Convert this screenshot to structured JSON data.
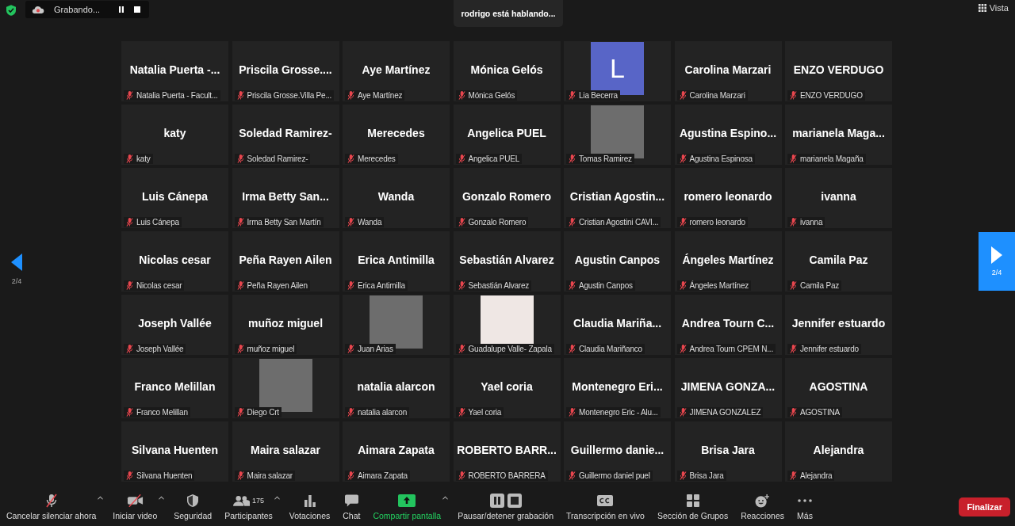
{
  "top_bar": {
    "recording": {
      "label": "Grabando...",
      "paused": false
    },
    "speaker": "rodrigo está hablando...",
    "view_button": "Vista"
  },
  "pager": {
    "left": "2/4",
    "right": "2/4"
  },
  "tiles": [
    {
      "kind": "name",
      "display": "Natalia Puerta -...",
      "label": "Natalia Puerta - Facult...",
      "muted": true
    },
    {
      "kind": "name",
      "display": "Priscila Grosse....",
      "label": "Priscila Grosse.Villa Pe...",
      "muted": true
    },
    {
      "kind": "name",
      "display": "Aye Martínez",
      "label": "Aye Martínez",
      "muted": true
    },
    {
      "kind": "name",
      "display": "Mónica Gelós",
      "label": "Mónica Gelós",
      "muted": true
    },
    {
      "kind": "avatar",
      "display": "L",
      "color": "#5865c7",
      "label": "Lia Becerra",
      "muted": true
    },
    {
      "kind": "name",
      "display": "Carolina Marzari",
      "label": "Carolina Marzari",
      "muted": true
    },
    {
      "kind": "name",
      "display": "ENZO VERDUGO",
      "label": "ENZO VERDUGO",
      "muted": true
    },
    {
      "kind": "name",
      "display": "katy",
      "label": "katy",
      "muted": true
    },
    {
      "kind": "name",
      "display": "Soledad Ramirez-",
      "label": "Soledad Ramirez-",
      "muted": true
    },
    {
      "kind": "name",
      "display": "Merecedes",
      "label": "Merecedes",
      "muted": true
    },
    {
      "kind": "name",
      "display": "Angelica PUEL",
      "label": "Angelica PUEL",
      "muted": true
    },
    {
      "kind": "photo",
      "label": "Tomas Ramirez",
      "muted": true
    },
    {
      "kind": "name",
      "display": "Agustina Espino...",
      "label": "Agustina Espinosa",
      "muted": true
    },
    {
      "kind": "name",
      "display": "marianela Maga...",
      "label": "marianela Magaña",
      "muted": true
    },
    {
      "kind": "name",
      "display": "Luis Cánepa",
      "label": "Luis Cánepa",
      "muted": true
    },
    {
      "kind": "name",
      "display": "Irma Betty San...",
      "label": "Irma Betty San Martín",
      "muted": true
    },
    {
      "kind": "name",
      "display": "Wanda",
      "label": "Wanda",
      "muted": true
    },
    {
      "kind": "name",
      "display": "Gonzalo Romero",
      "label": "Gonzalo Romero",
      "muted": true
    },
    {
      "kind": "name",
      "display": "Cristian Agostin...",
      "label": "Cristian Agostini CAVI...",
      "muted": true
    },
    {
      "kind": "name",
      "display": "romero leonardo",
      "label": "romero leonardo",
      "muted": true
    },
    {
      "kind": "name",
      "display": "ivanna",
      "label": "ivanna",
      "muted": true
    },
    {
      "kind": "name",
      "display": "Nicolas cesar",
      "label": "Nicolas cesar",
      "muted": true
    },
    {
      "kind": "name",
      "display": "Peña Rayen Ailen",
      "label": "Peña Rayen Ailen",
      "muted": true
    },
    {
      "kind": "name",
      "display": "Erica Antimilla",
      "label": "Erica Antimilla",
      "muted": true
    },
    {
      "kind": "name",
      "display": "Sebastián Alvarez",
      "label": "Sebastián Alvarez",
      "muted": true
    },
    {
      "kind": "name",
      "display": "Agustin Canpos",
      "label": "Agustin Canpos",
      "muted": true
    },
    {
      "kind": "name",
      "display": "Ángeles Martínez",
      "label": "Ángeles Martínez",
      "muted": true
    },
    {
      "kind": "name",
      "display": "Camila Paz",
      "label": "Camila Paz",
      "muted": true
    },
    {
      "kind": "name",
      "display": "Joseph Vallée",
      "label": "Joseph Vallée",
      "muted": true
    },
    {
      "kind": "name",
      "display": "muñoz miguel",
      "label": "muñoz miguel",
      "muted": true
    },
    {
      "kind": "photo",
      "label": "Juan Arias",
      "muted": true
    },
    {
      "kind": "logo",
      "label": "Guadalupe Valle- Zapala",
      "muted": true
    },
    {
      "kind": "name",
      "display": "Claudia Mariña...",
      "label": "Claudia Mariñanco",
      "muted": true
    },
    {
      "kind": "name",
      "display": "Andrea Tourn C...",
      "label": "Andrea Tourn CPEM N...",
      "muted": true
    },
    {
      "kind": "name",
      "display": "Jennifer estuardo",
      "label": "Jennifer estuardo",
      "muted": true
    },
    {
      "kind": "name",
      "display": "Franco Melillan",
      "label": "Franco Melillan",
      "muted": true
    },
    {
      "kind": "photo",
      "label": "Diego Crt",
      "muted": true
    },
    {
      "kind": "name",
      "display": "natalia alarcon",
      "label": "natalia alarcon",
      "muted": true
    },
    {
      "kind": "name",
      "display": "Yael coria",
      "label": "Yael coria",
      "muted": true
    },
    {
      "kind": "name",
      "display": "Montenegro Eri...",
      "label": "Montenegro Eric - Alu...",
      "muted": true
    },
    {
      "kind": "name",
      "display": "JIMENA GONZA...",
      "label": "JIMENA GONZALEZ",
      "muted": true
    },
    {
      "kind": "name",
      "display": "AGOSTINA",
      "label": "AGOSTINA",
      "muted": true
    },
    {
      "kind": "name",
      "display": "Silvana Huenten",
      "label": "Silvana Huenten",
      "muted": true
    },
    {
      "kind": "name",
      "display": "Maira salazar",
      "label": "Maira salazar",
      "muted": true
    },
    {
      "kind": "name",
      "display": "Aimara Zapata",
      "label": "Aimara Zapata",
      "muted": true
    },
    {
      "kind": "name",
      "display": "ROBERTO BARR...",
      "label": "ROBERTO BARRERA",
      "muted": true
    },
    {
      "kind": "name",
      "display": "Guillermo danie...",
      "label": "Guillermo daniel puel",
      "muted": true
    },
    {
      "kind": "name",
      "display": "Brisa Jara",
      "label": "Brisa Jara",
      "muted": true
    },
    {
      "kind": "name",
      "display": "Alejandra",
      "label": "Alejandra",
      "muted": true
    }
  ],
  "toolbar": [
    {
      "kind": "mic",
      "label": "Cancelar silenciar ahora",
      "caret": true
    },
    {
      "kind": "video",
      "label": "Iniciar video",
      "caret": true
    },
    {
      "kind": "security",
      "label": "Seguridad",
      "caret": false
    },
    {
      "kind": "participants",
      "label": "Participantes",
      "count": "175",
      "caret": true
    },
    {
      "kind": "polls",
      "label": "Votaciones",
      "caret": false
    },
    {
      "kind": "chat",
      "label": "Chat",
      "caret": false
    },
    {
      "kind": "share",
      "label": "Compartir pantalla",
      "caret": true
    },
    {
      "kind": "record",
      "label": "Pausar/detener grabación",
      "caret": false
    },
    {
      "kind": "cc",
      "label": "Transcripción en vivo",
      "caret": false
    },
    {
      "kind": "groups",
      "label": "Sección de Grupos",
      "caret": false
    },
    {
      "kind": "reactions",
      "label": "Reacciones",
      "caret": false
    },
    {
      "kind": "more",
      "label": "Más",
      "caret": false
    }
  ],
  "end_button": "Finalizar"
}
